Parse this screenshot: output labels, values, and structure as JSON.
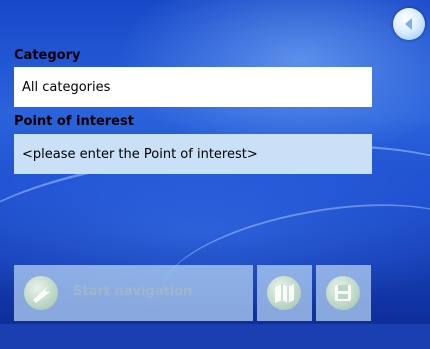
{
  "category": {
    "label": "Category",
    "value": "All categories"
  },
  "poi": {
    "label": "Point of interest",
    "placeholder": "<please enter the Point of interest>"
  },
  "buttons": {
    "start_navigation": "Start navigation"
  },
  "icons": {
    "back": "back-arrow-icon",
    "start": "navigation-arrow-icon",
    "map": "map-icon",
    "save": "save-disk-icon"
  },
  "colors": {
    "background": "#2a63dc",
    "field_selected": "#ffffff",
    "field_input": "#c9e0f7",
    "button_disabled_text": "#9fb6cc"
  }
}
